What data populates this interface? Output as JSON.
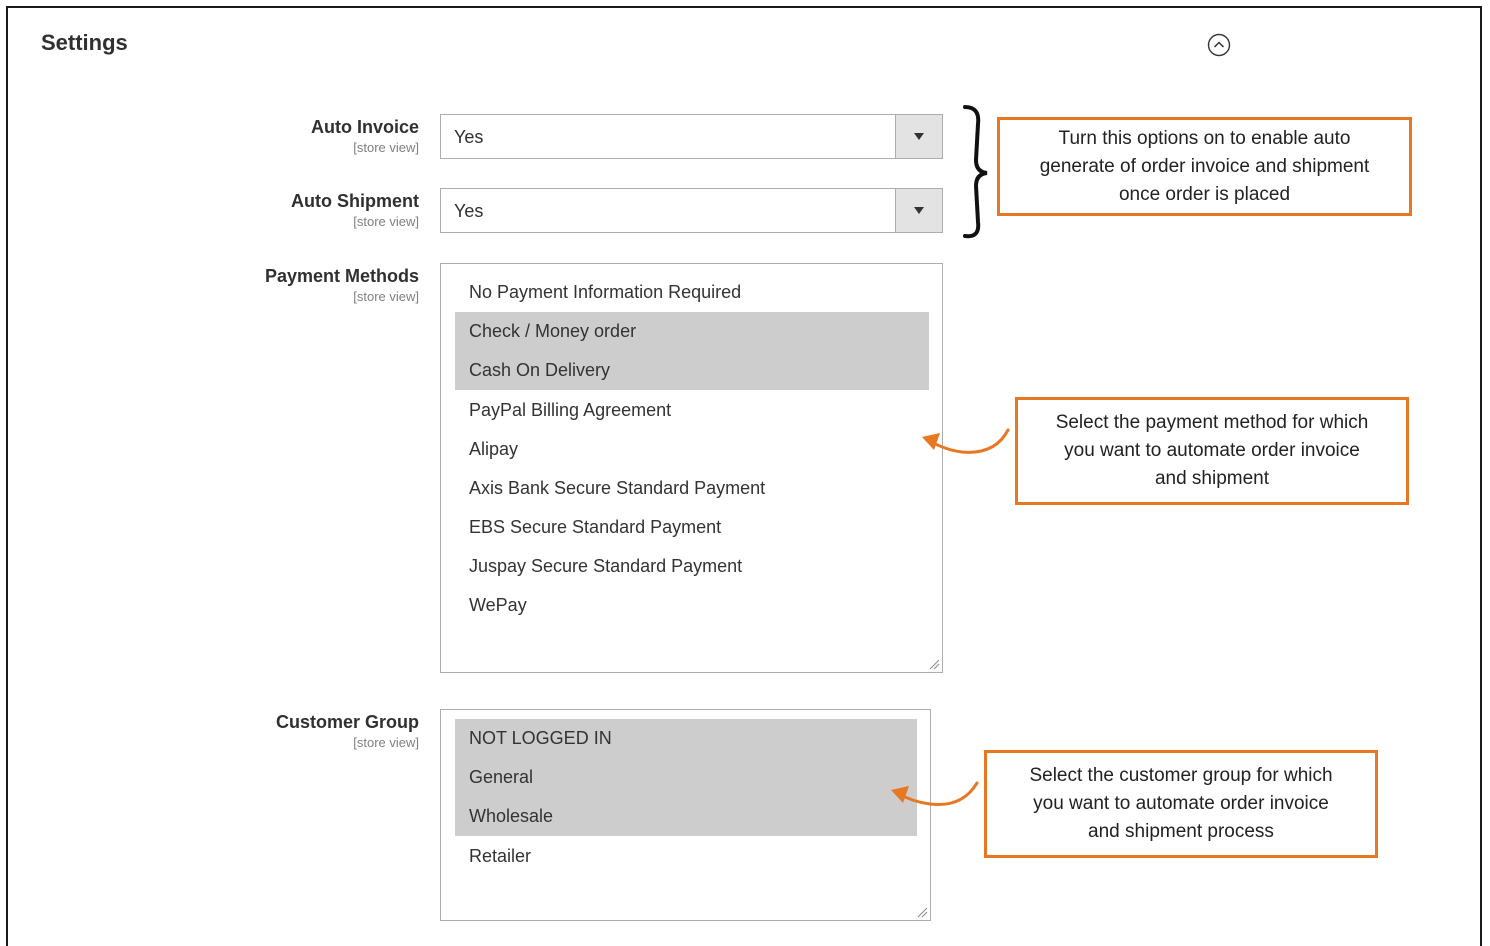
{
  "section": {
    "title": "Settings"
  },
  "fields": {
    "auto_invoice": {
      "label": "Auto Invoice",
      "scope": "[store view]",
      "value": "Yes"
    },
    "auto_shipment": {
      "label": "Auto Shipment",
      "scope": "[store view]",
      "value": "Yes"
    },
    "payment_methods": {
      "label": "Payment Methods",
      "scope": "[store view]",
      "options": [
        {
          "label": "No Payment Information Required",
          "selected": false
        },
        {
          "label": "Check / Money order",
          "selected": true
        },
        {
          "label": "Cash On Delivery",
          "selected": true
        },
        {
          "label": "PayPal Billing Agreement",
          "selected": false
        },
        {
          "label": "Alipay",
          "selected": false
        },
        {
          "label": "Axis Bank Secure Standard Payment",
          "selected": false
        },
        {
          "label": "EBS Secure Standard Payment",
          "selected": false
        },
        {
          "label": "Juspay Secure Standard Payment",
          "selected": false
        },
        {
          "label": "WePay",
          "selected": false
        }
      ]
    },
    "customer_group": {
      "label": "Customer Group",
      "scope": "[store view]",
      "options": [
        {
          "label": "NOT LOGGED IN",
          "selected": true
        },
        {
          "label": "General",
          "selected": true
        },
        {
          "label": "Wholesale",
          "selected": true
        },
        {
          "label": "Retailer",
          "selected": false
        }
      ]
    }
  },
  "callouts": {
    "auto": [
      "Turn this options on to enable auto",
      "generate of order invoice and shipment",
      "once order is placed"
    ],
    "payment": [
      "Select the payment method for which",
      "you want to automate order invoice",
      "and shipment"
    ],
    "customer": [
      "Select the customer group for which",
      "you want to automate order invoice",
      "and shipment process"
    ]
  },
  "colors": {
    "callout_border": "#e87722",
    "selected_option": "#cdcdcd"
  }
}
